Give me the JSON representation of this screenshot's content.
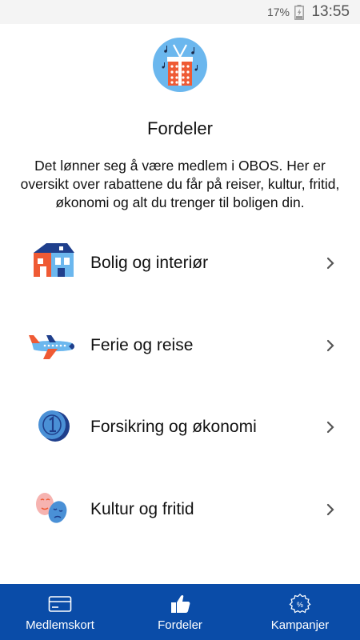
{
  "status_bar": {
    "battery": "17%",
    "time": "13:55"
  },
  "header": {
    "title": "Fordeler",
    "intro": "Det lønner seg å være medlem i OBOS. Her er oversikt over rabattene du får på reiser, kultur, fritid, økonomi og alt du trenger til boligen din."
  },
  "categories": [
    {
      "label": "Bolig og interiør",
      "icon": "house-icon"
    },
    {
      "label": "Ferie og reise",
      "icon": "airplane-icon"
    },
    {
      "label": "Forsikring og økonomi",
      "icon": "coin-icon"
    },
    {
      "label": "Kultur og fritid",
      "icon": "masks-icon"
    }
  ],
  "bottom_nav": {
    "items": [
      {
        "label": "Medlemskort",
        "icon": "card-icon"
      },
      {
        "label": "Fordeler",
        "icon": "thumbs-up-icon",
        "active": true
      },
      {
        "label": "Kampanjer",
        "icon": "percent-badge-icon"
      }
    ]
  },
  "colors": {
    "brand_blue": "#0a4ca8",
    "accent_orange": "#ef5a34",
    "light_blue": "#5aa8e6"
  }
}
